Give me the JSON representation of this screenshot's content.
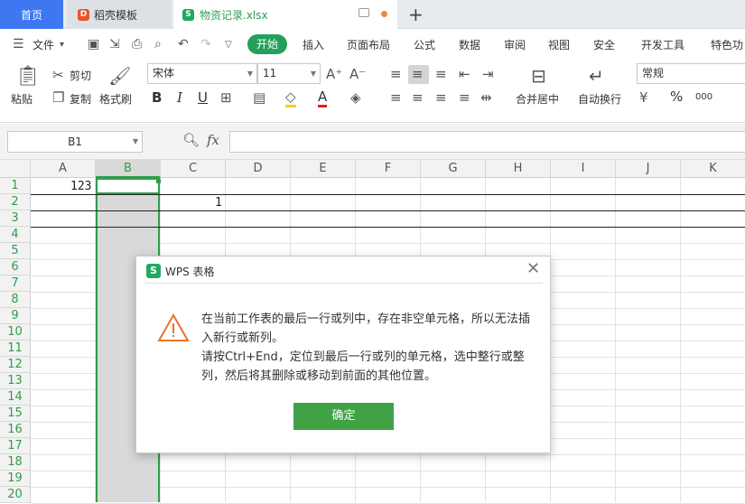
{
  "tabs": {
    "home": "首页",
    "templates": "稻壳模板",
    "file": "物资记录.xlsx",
    "new_tab": "+"
  },
  "menu": {
    "file": "文件",
    "start": "开始",
    "insert": "插入",
    "page_layout": "页面布局",
    "formulas": "公式",
    "data": "数据",
    "review": "审阅",
    "view": "视图",
    "security": "安全",
    "dev_tools": "开发工具",
    "special": "特色功"
  },
  "ribbon": {
    "paste": "粘贴",
    "cut": "剪切",
    "copy": "复制",
    "format_painter": "格式刷",
    "font_name": "宋体",
    "font_size": "11",
    "merge_center": "合并居中",
    "wrap_text": "自动换行",
    "number_format": "常规",
    "percent": "%",
    "thousands": "000"
  },
  "formula": {
    "name_box": "B1",
    "fx": "fx",
    "value": ""
  },
  "columns": [
    "A",
    "B",
    "C",
    "D",
    "E",
    "F",
    "G",
    "H",
    "I",
    "J",
    "K"
  ],
  "rows": [
    "1",
    "2",
    "3",
    "4",
    "5",
    "6",
    "7",
    "8",
    "9",
    "10",
    "11",
    "12",
    "13",
    "14",
    "15",
    "16",
    "17",
    "18",
    "19",
    "20"
  ],
  "cells": {
    "A1": "123",
    "C2": "1"
  },
  "selected_column": "B",
  "dialog": {
    "title": "WPS 表格",
    "message_1": "在当前工作表的最后一行或列中，存在非空单元格，所以无法插入新行或新列。",
    "message_2": "请按Ctrl+End，定位到最后一行或列的单元格，选中整行或整列，然后将其删除或移动到前面的其他位置。",
    "ok_button": "确定"
  },
  "colors": {
    "accent_green": "#23a15a",
    "home_tab_blue": "#3e77f0",
    "selection_green": "#2e9e4b",
    "warning_orange": "#e8742a"
  }
}
